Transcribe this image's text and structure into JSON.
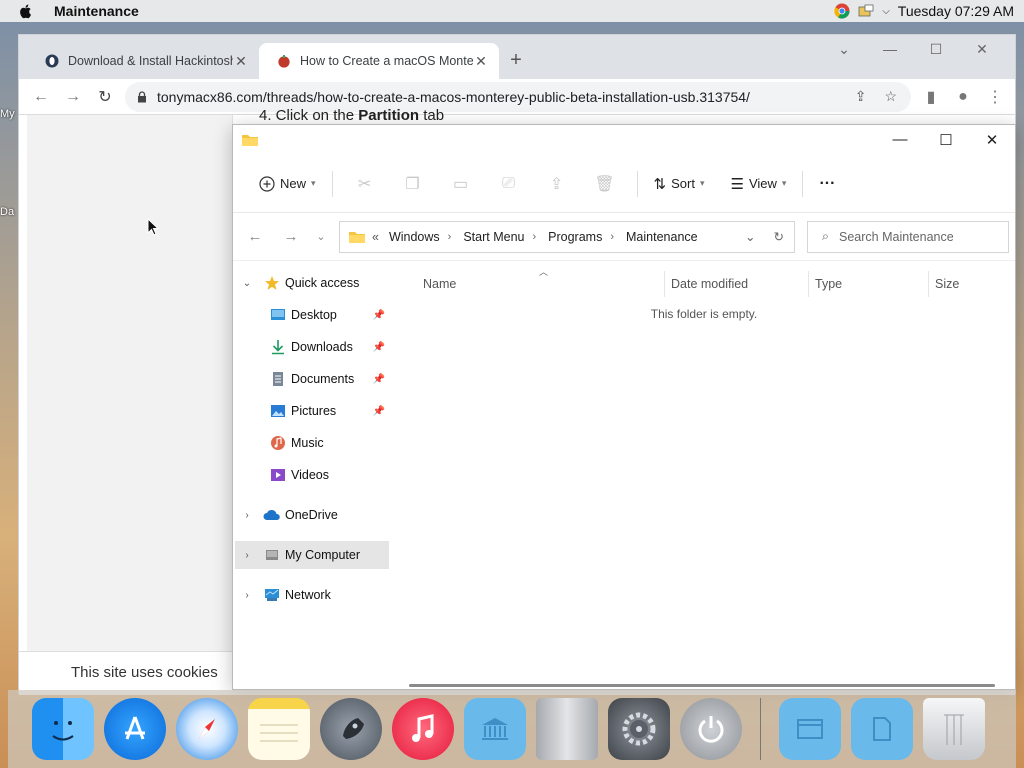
{
  "menubar": {
    "app_name": "Maintenance",
    "clock": "Tuesday 07:29 AM"
  },
  "desktop": {
    "labels": [
      "My",
      "Da"
    ]
  },
  "browser": {
    "tabs": [
      {
        "title": "Download & Install Hackintosh f"
      },
      {
        "title": "How to Create a macOS Montere"
      }
    ],
    "url": "tonymacx86.com/threads/how-to-create-a-macos-monterey-public-beta-installation-usb.313754/",
    "article_step_prefix": "4. Click on the ",
    "article_step_bold": "Partition",
    "article_step_suffix": " tab",
    "cookie_text": "This site uses cookies"
  },
  "explorer": {
    "toolbar": {
      "new_label": "New",
      "sort_label": "Sort",
      "view_label": "View",
      "more_label": "···"
    },
    "breadcrumb": [
      "Windows",
      "Start Menu",
      "Programs",
      "Maintenance"
    ],
    "breadcrumb_prefix": "«",
    "search_placeholder": "Search Maintenance",
    "nav": {
      "quick_access": "Quick access",
      "pinned": [
        {
          "label": "Desktop",
          "icon": "desktop-icon",
          "color": "#2a8fd6"
        },
        {
          "label": "Downloads",
          "icon": "download-icon",
          "color": "#1e9a61"
        },
        {
          "label": "Documents",
          "icon": "documents-icon",
          "color": "#7a8796"
        },
        {
          "label": "Pictures",
          "icon": "pictures-icon",
          "color": "#2a7bd6"
        },
        {
          "label": "Music",
          "icon": "music-icon",
          "color": "#e0674a"
        },
        {
          "label": "Videos",
          "icon": "videos-icon",
          "color": "#8a49c9"
        }
      ],
      "onedrive": "OneDrive",
      "my_computer": "My Computer",
      "network": "Network"
    },
    "columns": [
      "Name",
      "Date modified",
      "Type",
      "Size"
    ],
    "empty_text": "This folder is empty."
  },
  "dock": {
    "items": [
      "finder-icon",
      "app-store-icon",
      "safari-icon",
      "notes-icon",
      "launchpad-icon",
      "music-icon",
      "folder-icon",
      "mac-pro-icon",
      "system-preferences-icon",
      "power-icon",
      "folder-icon",
      "folder-icon",
      "trash-icon"
    ]
  }
}
